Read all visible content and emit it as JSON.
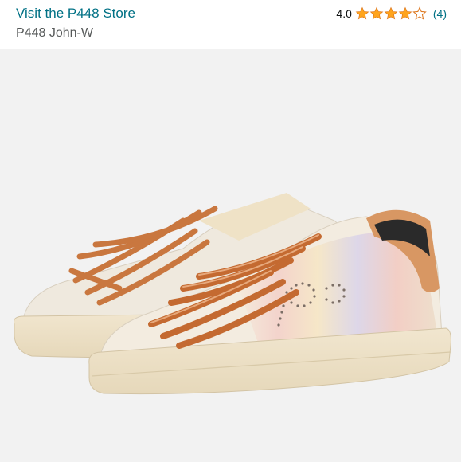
{
  "header": {
    "store_link": "Visit the P448 Store",
    "product_title": "P448 John-W"
  },
  "rating": {
    "value": "4.0",
    "stars": 4.0,
    "max_stars": 5,
    "count_label": "(4)"
  },
  "image": {
    "icon": "sneaker-product-photo",
    "background": "#f2f2f2"
  },
  "colors": {
    "link": "#007185",
    "star": "#ffa41c",
    "text": "#0f1111",
    "muted": "#565959"
  }
}
